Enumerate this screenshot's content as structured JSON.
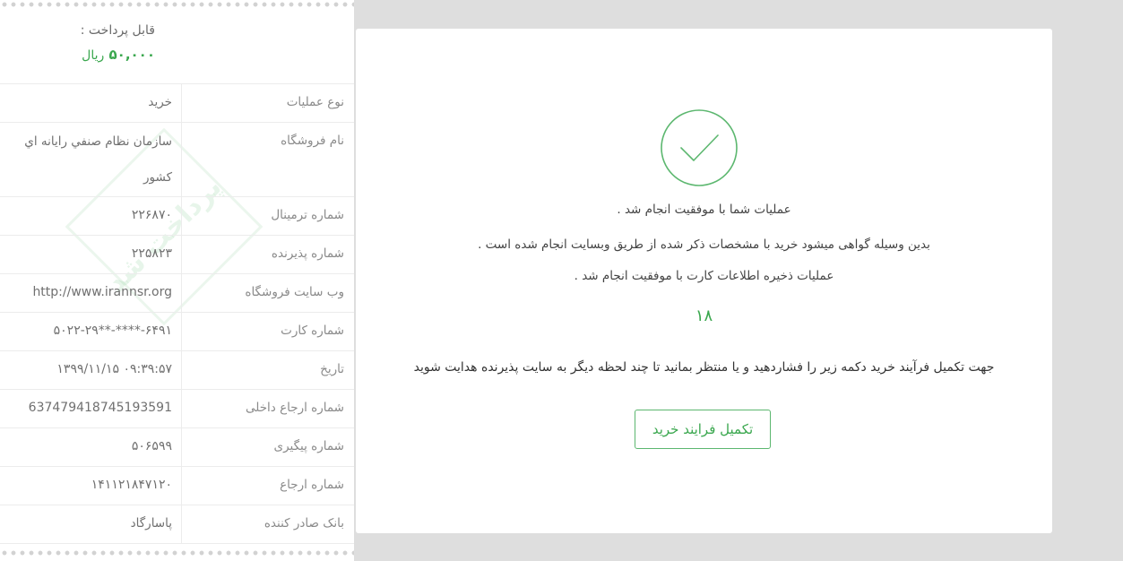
{
  "receipt": {
    "payable_label": "قابل پرداخت :",
    "payable_amount": "۵۰,۰۰۰",
    "payable_unit": "ریال",
    "watermark": "پرداخت شد",
    "rows": [
      {
        "label": "نوع عملیات",
        "value": "خرید"
      },
      {
        "label": "نام فروشگاه",
        "value": "سازمان نظام صنفي رايانه اي كشور"
      },
      {
        "label": "شماره ترمینال",
        "value": "۲۲۶۸۷۰"
      },
      {
        "label": "شماره پذیرنده",
        "value": "۲۲۵۸۲۳"
      },
      {
        "label": "وب سایت فروشگاه",
        "value": "http://www.irannsr.org"
      },
      {
        "label": "شماره کارت",
        "value": "۵۰۲۲-۲۹**-****-۶۴۹۱"
      },
      {
        "label": "تاریخ",
        "value": "۱۳۹۹/۱۱/۱۵ ۰۹:۳۹:۵۷"
      },
      {
        "label": "شماره ارجاع داخلی",
        "value": "637479418745193591"
      },
      {
        "label": "شماره پیگیری",
        "value": "۵۰۶۵۹۹"
      },
      {
        "label": "شماره ارجاع",
        "value": "۱۴۱۱۲۱۸۴۷۱۲۰"
      },
      {
        "label": "بانک صادر کننده",
        "value": "پاسارگاد"
      }
    ]
  },
  "result": {
    "success_icon": "check-circle-icon",
    "accent_color": "#3aa74e",
    "message_1": "عملیات شما با موفقیت انجام شد .",
    "message_2": "بدین وسیله گواهی میشود خرید با مشخصات ذکر شده از طریق وبسایت انجام شده است .",
    "message_3": "عملیات ذخیره اطلاعات کارت با موفقیت انجام شد .",
    "countdown": "۱۸",
    "instruction": "جهت تکمیل فرآیند خرید دکمه زیر را فشاردهید و یا منتظر بمانید تا چند لحظه دیگر به سایت پذیرنده هدایت شوید",
    "complete_button": "تکمیل فرایند خرید"
  }
}
